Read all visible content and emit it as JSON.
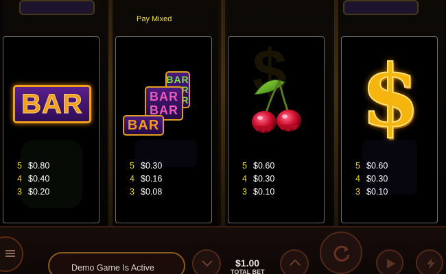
{
  "header": {
    "pay_mixed": "Pay Mixed"
  },
  "panels": [
    {
      "symbol": "bar-single",
      "symbol_text": "BAR",
      "pays": [
        {
          "count": "5",
          "amount": "$0.80"
        },
        {
          "count": "4",
          "amount": "$0.40"
        },
        {
          "count": "3",
          "amount": "$0.20"
        }
      ]
    },
    {
      "symbol": "bar-mixed",
      "symbol_text": "BAR",
      "pays": [
        {
          "count": "5",
          "amount": "$0.30"
        },
        {
          "count": "4",
          "amount": "$0.16"
        },
        {
          "count": "3",
          "amount": "$0.08"
        }
      ]
    },
    {
      "symbol": "cherries",
      "pays": [
        {
          "count": "5",
          "amount": "$0.60"
        },
        {
          "count": "4",
          "amount": "$0.30"
        },
        {
          "count": "3",
          "amount": "$0.10"
        }
      ]
    },
    {
      "symbol": "dollar-sign",
      "symbol_text": "$",
      "pays": [
        {
          "count": "5",
          "amount": "$0.60"
        },
        {
          "count": "4",
          "amount": "$0.30"
        },
        {
          "count": "3",
          "amount": "$0.10"
        }
      ]
    }
  ],
  "footer": {
    "demo_text": "Demo Game Is Active",
    "bet_value": "$1.00",
    "bet_label": "TOTAL BET"
  },
  "colors": {
    "pay_count": "#f2d428",
    "pay_amount": "#ffffff",
    "title": "#f2e04a",
    "panel_border": "#6e6e6e"
  }
}
